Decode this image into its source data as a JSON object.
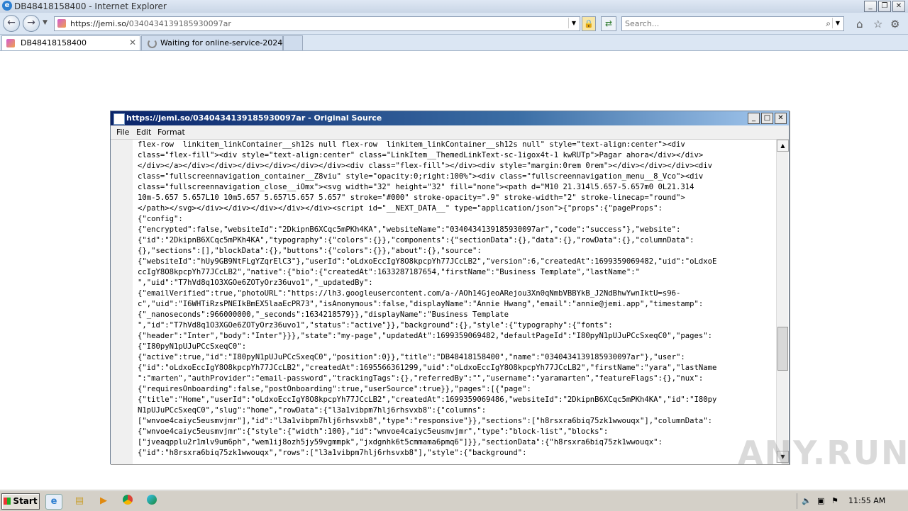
{
  "browser": {
    "window_title": "DB48418158400 - Internet Explorer",
    "url_host": "https://jemi.so/",
    "url_path": "0340434139185930097ar",
    "search_placeholder": "Search..."
  },
  "tabs": [
    {
      "label": "DB48418158400"
    },
    {
      "label": "Waiting for online-service-2024-..."
    }
  ],
  "source_window": {
    "title": "https://jemi.so/0340434139185930097ar - Original Source",
    "menu": [
      "File",
      "Edit",
      "Format"
    ],
    "lines": [
      "flex-row  linkitem_linkContainer__sh12s null flex-row  linkitem_linkContainer__sh12s null\" style=\"text-align:center\"><div",
      "class=\"flex-fill\"><div style=\"text-align:center\" class=\"LinkItem__ThemedLinkText-sc-1igox4t-1 kwRUTp\">Pagar ahora</div></div>",
      "</div></a></div></div></div></div></div></div><div class=\"flex-fill\"></div><div style=\"margin:0rem 0rem\"></div></div></div><div",
      "class=\"fullscreennavigation_container__Z8viu\" style=\"opacity:0;right:100%\"><div class=\"fullscreennavigation_menu__8_Vco\"><div",
      "class=\"fullscreennavigation_close__iOmx\"><svg width=\"32\" height=\"32\" fill=\"none\"><path d=\"M10 21.314l5.657-5.657m0 0L21.314",
      "10m-5.657 5.657L10 10m5.657 5.657l5.657 5.657\" stroke=\"#000\" stroke-opacity=\".9\" stroke-width=\"2\" stroke-linecap=\"round\">",
      "</path></svg></div></div></div></div></div><script id=\"__NEXT_DATA__\" type=\"application/json\">{\"props\":{\"pageProps\":",
      "{\"config\":",
      "{\"encrypted\":false,\"websiteId\":\"2DkipnB6XCqc5mPKh4KA\",\"websiteName\":\"0340434139185930097ar\",\"code\":\"success\"},\"website\":",
      "{\"id\":\"2DkipnB6XCqc5mPKh4KA\",\"typography\":{\"colors\":{}},\"components\":{\"sectionData\":{},\"data\":{},\"rowData\":{},\"columnData\":",
      "{},\"sections\":[],\"blockData\":{},\"buttons\":{\"colors\":{}},\"about\":{},\"source\":",
      "{\"websiteId\":\"hUy9GB9NtFLgYZqrElC3\"},\"userId\":\"oLdxoEccIgY8O8kpcpYh77JCcLB2\",\"version\":6,\"createdAt\":1699359069482,\"uid\":\"oLdxoE",
      "ccIgY8O8kpcpYh77JCcLB2\",\"native\":{\"bio\":{\"createdAt\":1633287187654,\"firstName\":\"Business Template\",\"lastName\":\"",
      "\",\"uid\":\"T7hVd8q1O3XGOe6ZOTyOrz36uvo1\",\"_updatedBy\":",
      "{\"emailVerified\":true,\"photoURL\":\"https://lh3.googleusercontent.com/a-/AOh14GjeoARejou3Xn0qNmbVBBYkB_J2NdBhwYwnIktU=s96-",
      "c\",\"uid\":\"I6WHTiRzsPNEIkBmEX5laaEcPR73\",\"isAnonymous\":false,\"displayName\":\"Annie Hwang\",\"email\":\"annie@jemi.app\",\"timestamp\":",
      "{\"_nanoseconds\":966000000,\"_seconds\":1634218579}},\"displayName\":\"Business Template",
      "\",\"id\":\"T7hVd8q1O3XGOe6ZOTyOrz36uvo1\",\"status\":\"active\"}},\"background\":{},\"style\":{\"typography\":{\"fonts\":",
      "{\"header\":\"Inter\",\"body\":\"Inter\"}}},\"state\":\"my-page\",\"updatedAt\":1699359069482,\"defaultPageId\":\"I80pyN1pUJuPCcSxeqC0\",\"pages\":",
      "{\"I80pyN1pUJuPCcSxeqC0\":",
      "{\"active\":true,\"id\":\"I80pyN1pUJuPCcSxeqC0\",\"position\":0}},\"title\":\"DB48418158400\",\"name\":\"0340434139185930097ar\"},\"user\":",
      "{\"id\":\"oLdxoEccIgY8O8kpcpYh77JCcLB2\",\"createdAt\":1695566361299,\"uid\":\"oLdxoEccIgY8O8kpcpYh77JCcLB2\",\"firstName\":\"yara\",\"lastName",
      "\":\"marten\",\"authProvider\":\"email-password\",\"trackingTags\":{},\"referredBy\":\"\",\"username\":\"yaramarten\",\"featureFlags\":{},\"nux\":",
      "{\"requiresOnboarding\":false,\"postOnboarding\":true,\"userSource\":true}},\"pages\":[{\"page\":",
      "{\"title\":\"Home\",\"userId\":\"oLdxoEccIgY8O8kpcpYh77JCcLB2\",\"createdAt\":1699359069486,\"websiteId\":\"2DkipnB6XCqc5mPKh4KA\",\"id\":\"I80py",
      "N1pUJuPCcSxeqC0\",\"slug\":\"home\",\"rowData\":{\"l3a1vibpm7hlj6rhsvxb8\":{\"columns\":",
      "[\"wnvoe4caiyc5eusmvjmr\"],\"id\":\"l3a1vibpm7hlj6rhsvxb8\",\"type\":\"responsive\"}},\"sections\":[\"h8rsxra6biq75zk1wwouqx\"],\"columnData\":",
      "{\"wnvoe4caiyc5eusmvjmr\":{\"style\":{\"width\":100},\"id\":\"wnvoe4caiyc5eusmvjmr\",\"type\":\"block-list\",\"blocks\":",
      "[\"jveaqpplu2r1mlv9um6ph\",\"wem1ij8ozh5jy59vgmmpk\",\"jxdgnhk6t5cmmama6pmq6\"]}},\"sectionData\":{\"h8rsxra6biq75zk1wwouqx\":",
      "{\"id\":\"h8rsxra6biq75zk1wwouqx\",\"rows\":[\"l3a1vibpm7hlj6rhsvxb8\"],\"style\":{\"background\":"
    ]
  },
  "watermark": "ANY.RUN",
  "taskbar": {
    "start_label": "Start",
    "clock": "11:55 AM"
  }
}
